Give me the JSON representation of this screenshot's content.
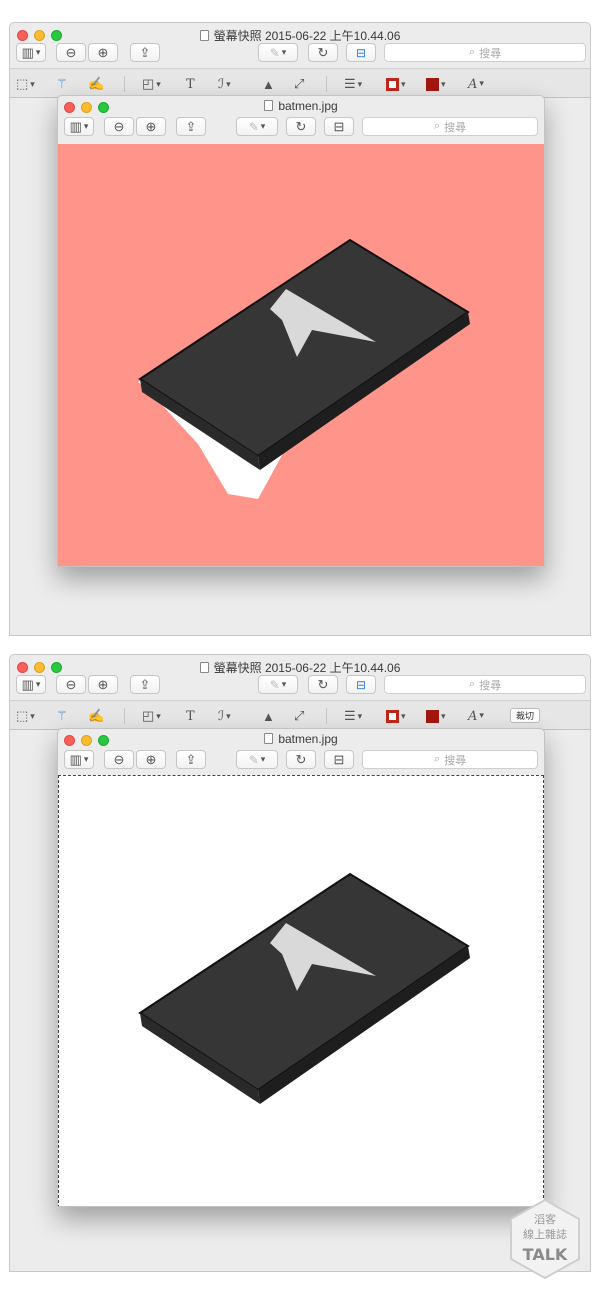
{
  "outer_window": {
    "title": "螢幕快照 2015-06-22 上午10.44.06",
    "search_placeholder": "搜尋"
  },
  "inner_window": {
    "title": "batmen.jpg",
    "search_placeholder": "搜尋"
  },
  "crop_button_label": "裁切",
  "colors": {
    "canvas_background_before": "#ff958a",
    "canvas_background_after": "#ffffff",
    "border_color_swatch": "#c0271c",
    "fill_color_swatch": "#a3180f"
  },
  "icons": {
    "sidebar": "sidebar-icon",
    "zoom_out": "zoom-out-icon",
    "zoom_in": "zoom-in-icon",
    "share": "share-icon",
    "pen": "pen-icon",
    "rotate": "rotate-icon",
    "toolbox": "toolbox-icon",
    "rect_select": "rectangular-selection-icon",
    "instant_alpha": "magic-wand-icon",
    "sketch": "sketch-icon",
    "shapes": "shapes-icon",
    "text": "text-icon",
    "signature": "signature-icon",
    "adjust_color": "adjust-color-icon",
    "adjust_size": "adjust-size-icon",
    "line_style": "line-style-icon",
    "border_color": "border-color-icon",
    "fill_color": "fill-color-icon",
    "font": "font-icon"
  },
  "watermark": {
    "line1": "滔客",
    "line2": "線上雜誌",
    "logo": "TALK"
  }
}
